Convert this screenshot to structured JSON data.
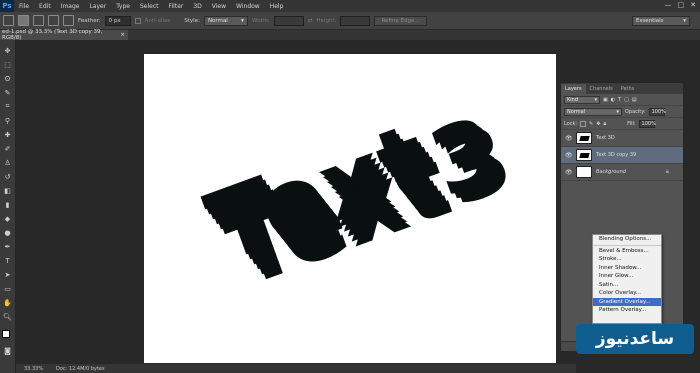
{
  "app": {
    "logo_text": "Ps"
  },
  "menu": [
    "File",
    "Edit",
    "Image",
    "Layer",
    "Type",
    "Select",
    "Filter",
    "3D",
    "View",
    "Window",
    "Help"
  ],
  "window_controls": {
    "minimize": "—",
    "restore": "□",
    "close": "✕"
  },
  "options_bar": {
    "feather_label": "Feather:",
    "feather_value": "0 px",
    "antialias_label": "Anti-alias",
    "style_label": "Style:",
    "style_value": "Normal",
    "width_label": "Width:",
    "height_label": "Height:",
    "refine_edge_label": "Refine Edge...",
    "workspace_value": "Essentials"
  },
  "document_tab": {
    "title": "ed-1.psd @ 33.3% (Text 3D copy 39, RGB/8)",
    "close": "×"
  },
  "status_bar": {
    "zoom": "33.33%",
    "doc_info": "Doc: 12.4M/0 bytes"
  },
  "layers_panel": {
    "tabs": [
      "Layers",
      "Channels",
      "Paths"
    ],
    "active_tab": "Layers",
    "filter_value": "Kind",
    "blend_mode": "Normal",
    "opacity_label": "Opacity:",
    "opacity_value": "100%",
    "lock_label": "Lock:",
    "fill_label": "Fill:",
    "fill_value": "100%",
    "layers": [
      {
        "name": "Text 3D",
        "selected": false
      },
      {
        "name": "Text 3D copy 39",
        "selected": true
      },
      {
        "name": "Background",
        "selected": false
      }
    ]
  },
  "context_menu": {
    "items": [
      "Blending Options...",
      "Bevel & Emboss...",
      "Stroke...",
      "Inner Shadow...",
      "Inner Glow...",
      "Satin...",
      "Color Overlay...",
      "Gradient Overlay...",
      "Pattern Overlay..."
    ],
    "highlighted": "Gradient Overlay..."
  },
  "canvas_art": {
    "text": "Text 3D",
    "color": "#0a0f0f"
  },
  "watermark": {
    "text": "ساعدنیوز"
  },
  "colors": {
    "selection_blue": "#3c6fc4",
    "layer_selected": "#5e6c7d",
    "watermark_bg": "#0f5e8f"
  }
}
